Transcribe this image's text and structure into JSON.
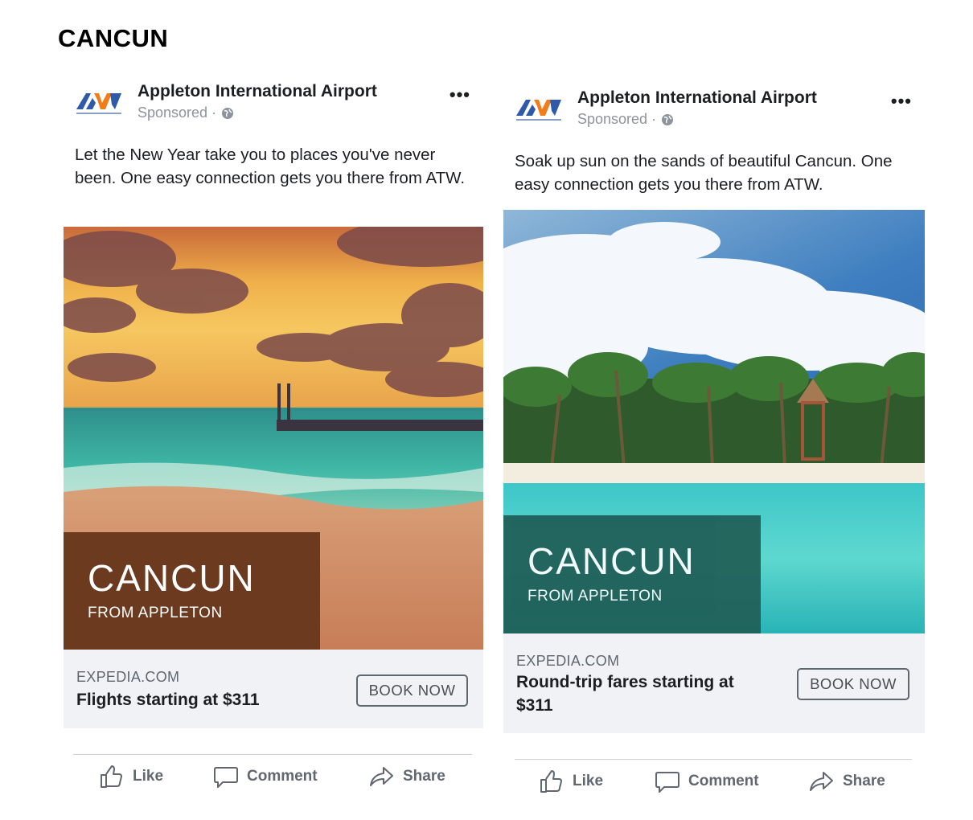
{
  "page": {
    "title": "CANCUN"
  },
  "ads": [
    {
      "advertiser": "Appleton International Airport",
      "sponsored": "Sponsored ·",
      "copy": "Let the New Year take you to places you've never been. One easy connection gets you there from ATW.",
      "overlay_title": "CANCUN",
      "overlay_subtitle": "FROM APPLETON",
      "overlay_color": "#6b3a1f",
      "domain": "EXPEDIA.COM",
      "headline": "Flights starting at $311",
      "cta": "BOOK NOW",
      "actions": {
        "like": "Like",
        "comment": "Comment",
        "share": "Share"
      }
    },
    {
      "advertiser": "Appleton International Airport",
      "sponsored": "Sponsored ·",
      "copy": "Soak up sun on the sands of beautiful Cancun. One easy connection gets you there from ATW.",
      "overlay_title": "CANCUN",
      "overlay_subtitle": "FROM APPLETON",
      "overlay_color": "#1f5d56",
      "domain": "EXPEDIA.COM",
      "headline": "Round-trip fares starting at $311",
      "cta": "BOOK NOW",
      "actions": {
        "like": "Like",
        "comment": "Comment",
        "share": "Share"
      }
    }
  ],
  "colors": {
    "footer_bg": "#f0f2f5",
    "logo_blue": "#2e5aa8",
    "logo_orange": "#f07d1a"
  },
  "icons": [
    "more-icon",
    "globe-icon",
    "like-icon",
    "comment-icon",
    "share-icon"
  ]
}
